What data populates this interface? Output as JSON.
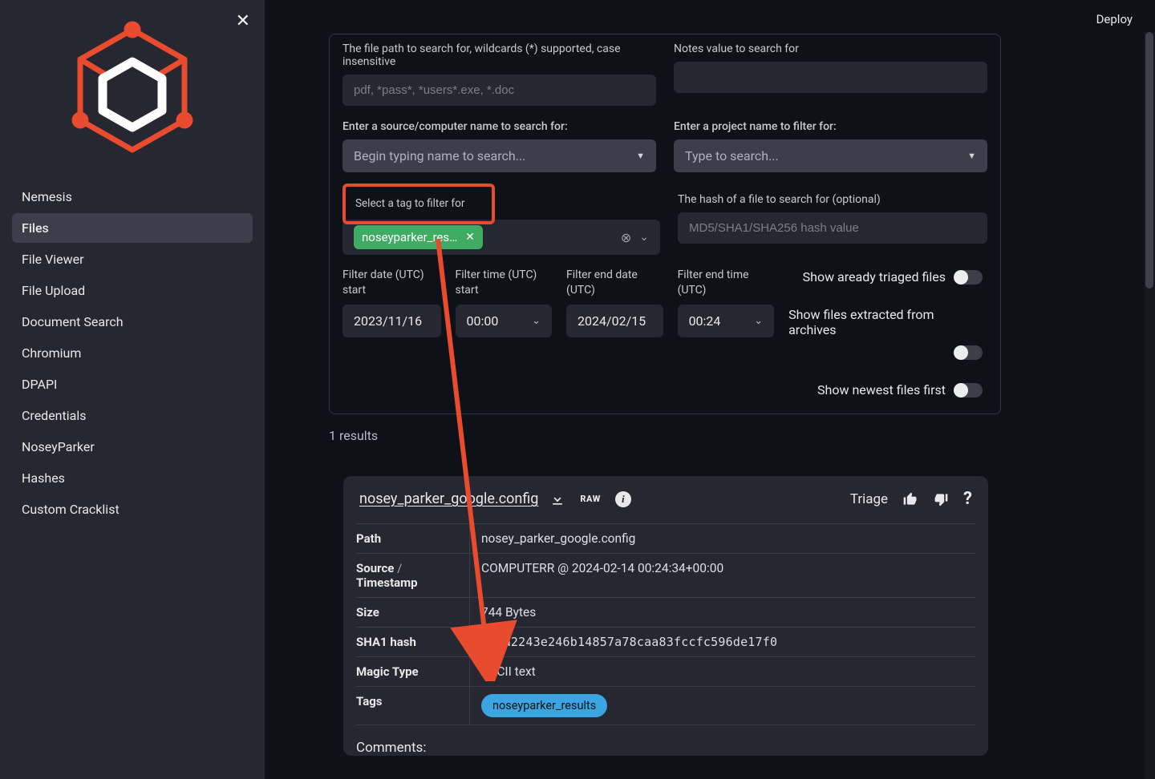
{
  "topbar": {
    "deploy": "Deploy"
  },
  "sidebar": {
    "items": [
      {
        "label": "Nemesis"
      },
      {
        "label": "Files"
      },
      {
        "label": "File Viewer"
      },
      {
        "label": "File Upload"
      },
      {
        "label": "Document Search"
      },
      {
        "label": "Chromium"
      },
      {
        "label": "DPAPI"
      },
      {
        "label": "Credentials"
      },
      {
        "label": "NoseyParker"
      },
      {
        "label": "Hashes"
      },
      {
        "label": "Custom Cracklist"
      }
    ]
  },
  "filters": {
    "path_label": "The file path to search for, wildcards (*) supported, case insensitive",
    "path_placeholder": "pdf, *pass*, *users*.exe, *.doc",
    "notes_label": "Notes value to search for",
    "source_label": "Enter a source/computer name to search for:",
    "source_placeholder": "Begin typing name to search...",
    "project_label": "Enter a project name to filter for:",
    "project_placeholder": "Type to search...",
    "tag_label": "Select a tag to filter for",
    "tag_chip": "noseyparker_res…",
    "hash_label": "The hash of a file to search for (optional)",
    "hash_placeholder": "MD5/SHA1/SHA256 hash value",
    "date_start_label": "Filter date (UTC) start",
    "date_start_value": "2023/11/16",
    "time_start_label": "Filter time (UTC) start",
    "time_start_value": "00:00",
    "date_end_label": "Filter end date (UTC)",
    "date_end_value": "2024/02/15",
    "time_end_label": "Filter end time (UTC)",
    "time_end_value": "00:24",
    "toggle_triaged": "Show aready triaged files",
    "toggle_extracted": "Show files extracted from archives",
    "toggle_newest": "Show newest files first"
  },
  "results": {
    "count_text": "1 results"
  },
  "card": {
    "title": "nosey_parker_google.config",
    "raw_label": "RAW",
    "triage_label": "Triage",
    "rows": {
      "path_key": "Path",
      "path_val": "nosey_parker_google.config",
      "source_key_a": "Source",
      "source_key_sep": " / ",
      "source_key_b": "Timestamp",
      "source_val": "COMPUTERR @ 2024-02-14 00:24:34+00:00",
      "size_key": "Size",
      "size_val": "744 Bytes",
      "sha1_key": "SHA1 hash",
      "sha1_val": "7a1a2243e246b14857a78caa83fccfc596de17f0",
      "magic_key": "Magic Type",
      "magic_val": "ASCII text",
      "tags_key": "Tags",
      "tags_pill": "noseyparker_results"
    },
    "comments_label": "Comments:"
  }
}
